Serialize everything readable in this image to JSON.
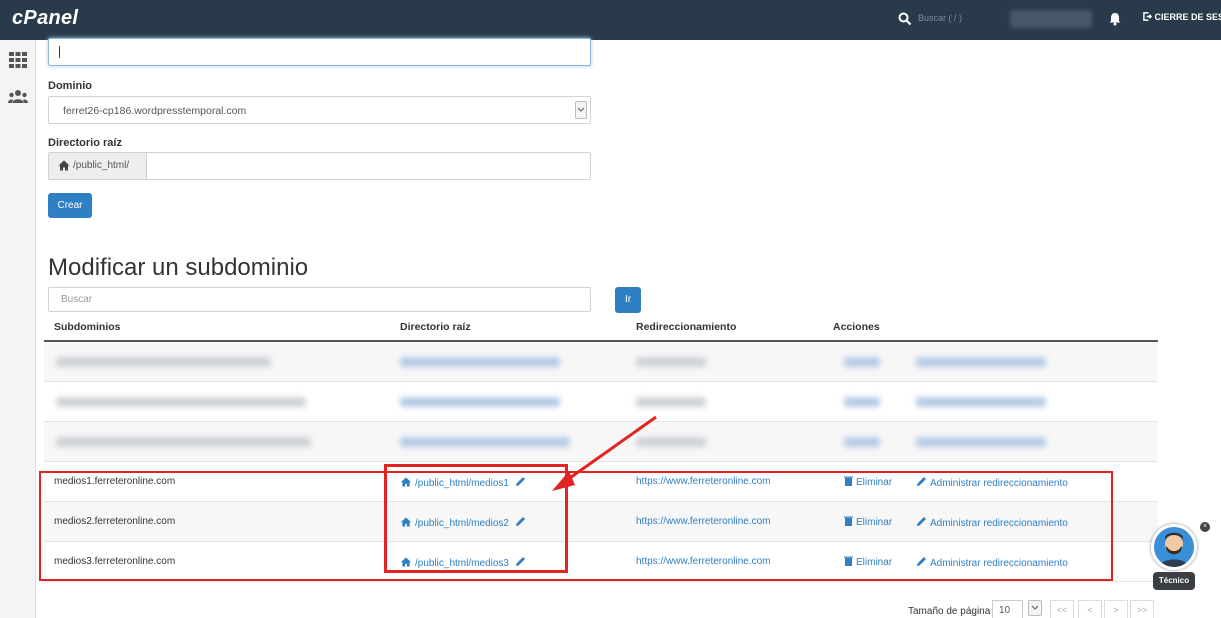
{
  "header": {
    "logo": "cPanel",
    "search_placeholder": "Buscar ( / )",
    "logout_label": "CIERRE DE SESIÓN"
  },
  "form": {
    "domain_label": "Dominio",
    "domain_value": "ferret26-cp186.wordpresstemporal.com",
    "root_dir_label": "Directorio raíz",
    "root_dir_prefix": "/public_html/",
    "create_button": "Crear"
  },
  "modify": {
    "title": "Modificar un subdominio",
    "search_placeholder": "Buscar",
    "go_button": "Ir",
    "columns": [
      "Subdominios",
      "Directorio raíz",
      "Redireccionamiento",
      "Acciones"
    ],
    "rows": [
      {
        "subdomain": "medios1.ferreteronline.com",
        "root": "/public_html/medios1",
        "redirect": "https://www.ferreteronline.com",
        "delete": "Eliminar",
        "manage": "Administrar redireccionamiento"
      },
      {
        "subdomain": "medios2.ferreteronline.com",
        "root": "/public_html/medios2",
        "redirect": "https://www.ferreteronline.com",
        "delete": "Eliminar",
        "manage": "Administrar redireccionamiento"
      },
      {
        "subdomain": "medios3.ferreteronline.com",
        "root": "/public_html/medios3",
        "redirect": "https://www.ferreteronline.com",
        "delete": "Eliminar",
        "manage": "Administrar redireccionamiento"
      }
    ]
  },
  "pagination": {
    "page_size_label": "Tamaño de página",
    "page_size": "10",
    "first": "<<",
    "prev": "<",
    "next": ">",
    "last": ">>"
  },
  "chat": {
    "label": "Técnico"
  },
  "colors": {
    "topbar": "#293a4a",
    "primary": "#2f7fc4",
    "annotation": "#e32222"
  }
}
